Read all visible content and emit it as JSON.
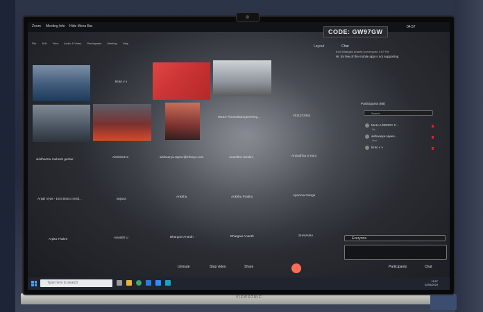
{
  "window": {
    "titles": [
      "Zoom",
      "Meeting Info",
      "Hide Menu Bar"
    ]
  },
  "menu": [
    "File",
    "Edit",
    "View",
    "Audio & Video",
    "Participants",
    "Meeting",
    "Help"
  ],
  "meeting_code": "CODE: GW97GW",
  "clock": "04:57",
  "layout_label": "Layout",
  "tiles": [
    {
      "name": "kiran v v"
    },
    {
      "name": "W162-ThumaIlaEngineering..."
    },
    {
      "name": "2511072354"
    },
    {
      "name": "siddhantra mahesh gurbar"
    },
    {
      "name": "Abhishek S"
    },
    {
      "name": "aishwarya.rajeev@infosys.com"
    },
    {
      "name": "Anandha Vandini"
    },
    {
      "name": "Anirudhha S Kant"
    },
    {
      "name": "Anjali Vyas - Don Bosco Instit..."
    },
    {
      "name": "anjana"
    },
    {
      "name": "Ankitha"
    },
    {
      "name": "Ankitha Prabhu"
    },
    {
      "name": "Apoorva Ganga"
    },
    {
      "name": "Arpita Thakre"
    },
    {
      "name": "Aswathi U"
    },
    {
      "name": "Bhargavi Ananth"
    },
    {
      "name": "Bhargavi Ananth"
    },
    {
      "name": "SHAVANA"
    }
  ],
  "chat": {
    "header": "Chat",
    "from": "from Bhargavi Ananth to everyone  1:57 PM",
    "message": "Hi, for few of the mobile app is not supporting"
  },
  "participants": {
    "title": "Participants (88)",
    "search_placeholder": "Search",
    "list": [
      {
        "name": "MALLA REDDY C...",
        "role": "Me"
      },
      {
        "name": "aishwarya.rajeev...",
        "role": "Host"
      },
      {
        "name": "kiran v v",
        "role": ""
      }
    ]
  },
  "chat_to": "Everyone",
  "controls": {
    "unmute": "Unmute",
    "stop_video": "Stop video",
    "share": "Share",
    "participants": "Participants",
    "chat": "Chat"
  },
  "taskbar": {
    "search_placeholder": "Type here to search",
    "time": "15:07",
    "date": "02/06/2024"
  },
  "stand_brand": "VIEWSONIC"
}
